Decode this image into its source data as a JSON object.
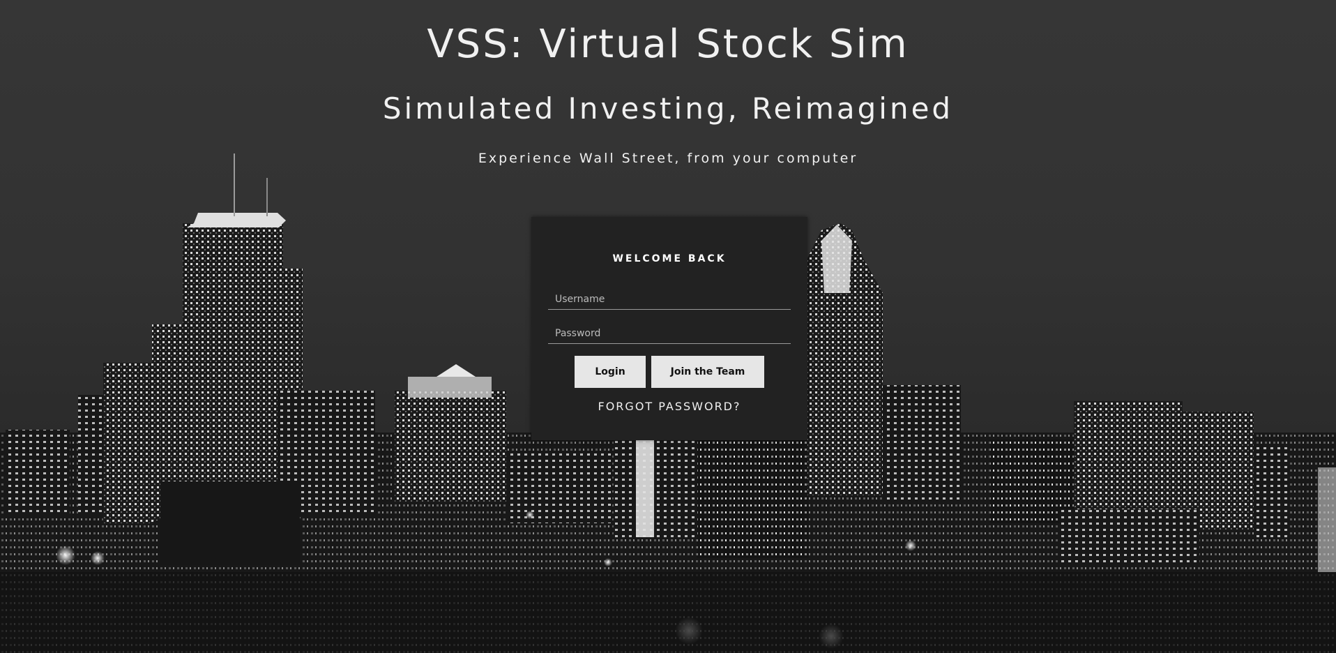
{
  "hero": {
    "title": "VSS: Virtual Stock Sim",
    "subtitle": "Simulated Investing, Reimagined",
    "tagline": "Experience Wall Street, from your computer"
  },
  "login": {
    "heading": "WELCOME BACK",
    "username_placeholder": "Username",
    "password_placeholder": "Password",
    "login_label": "Login",
    "join_label": "Join the Team",
    "forgot_label": "FORGOT PASSWORD?"
  },
  "colors": {
    "background": "#2e2e2e",
    "card": "#222222",
    "button": "#e6e6e6",
    "text": "#f1f1f1"
  }
}
